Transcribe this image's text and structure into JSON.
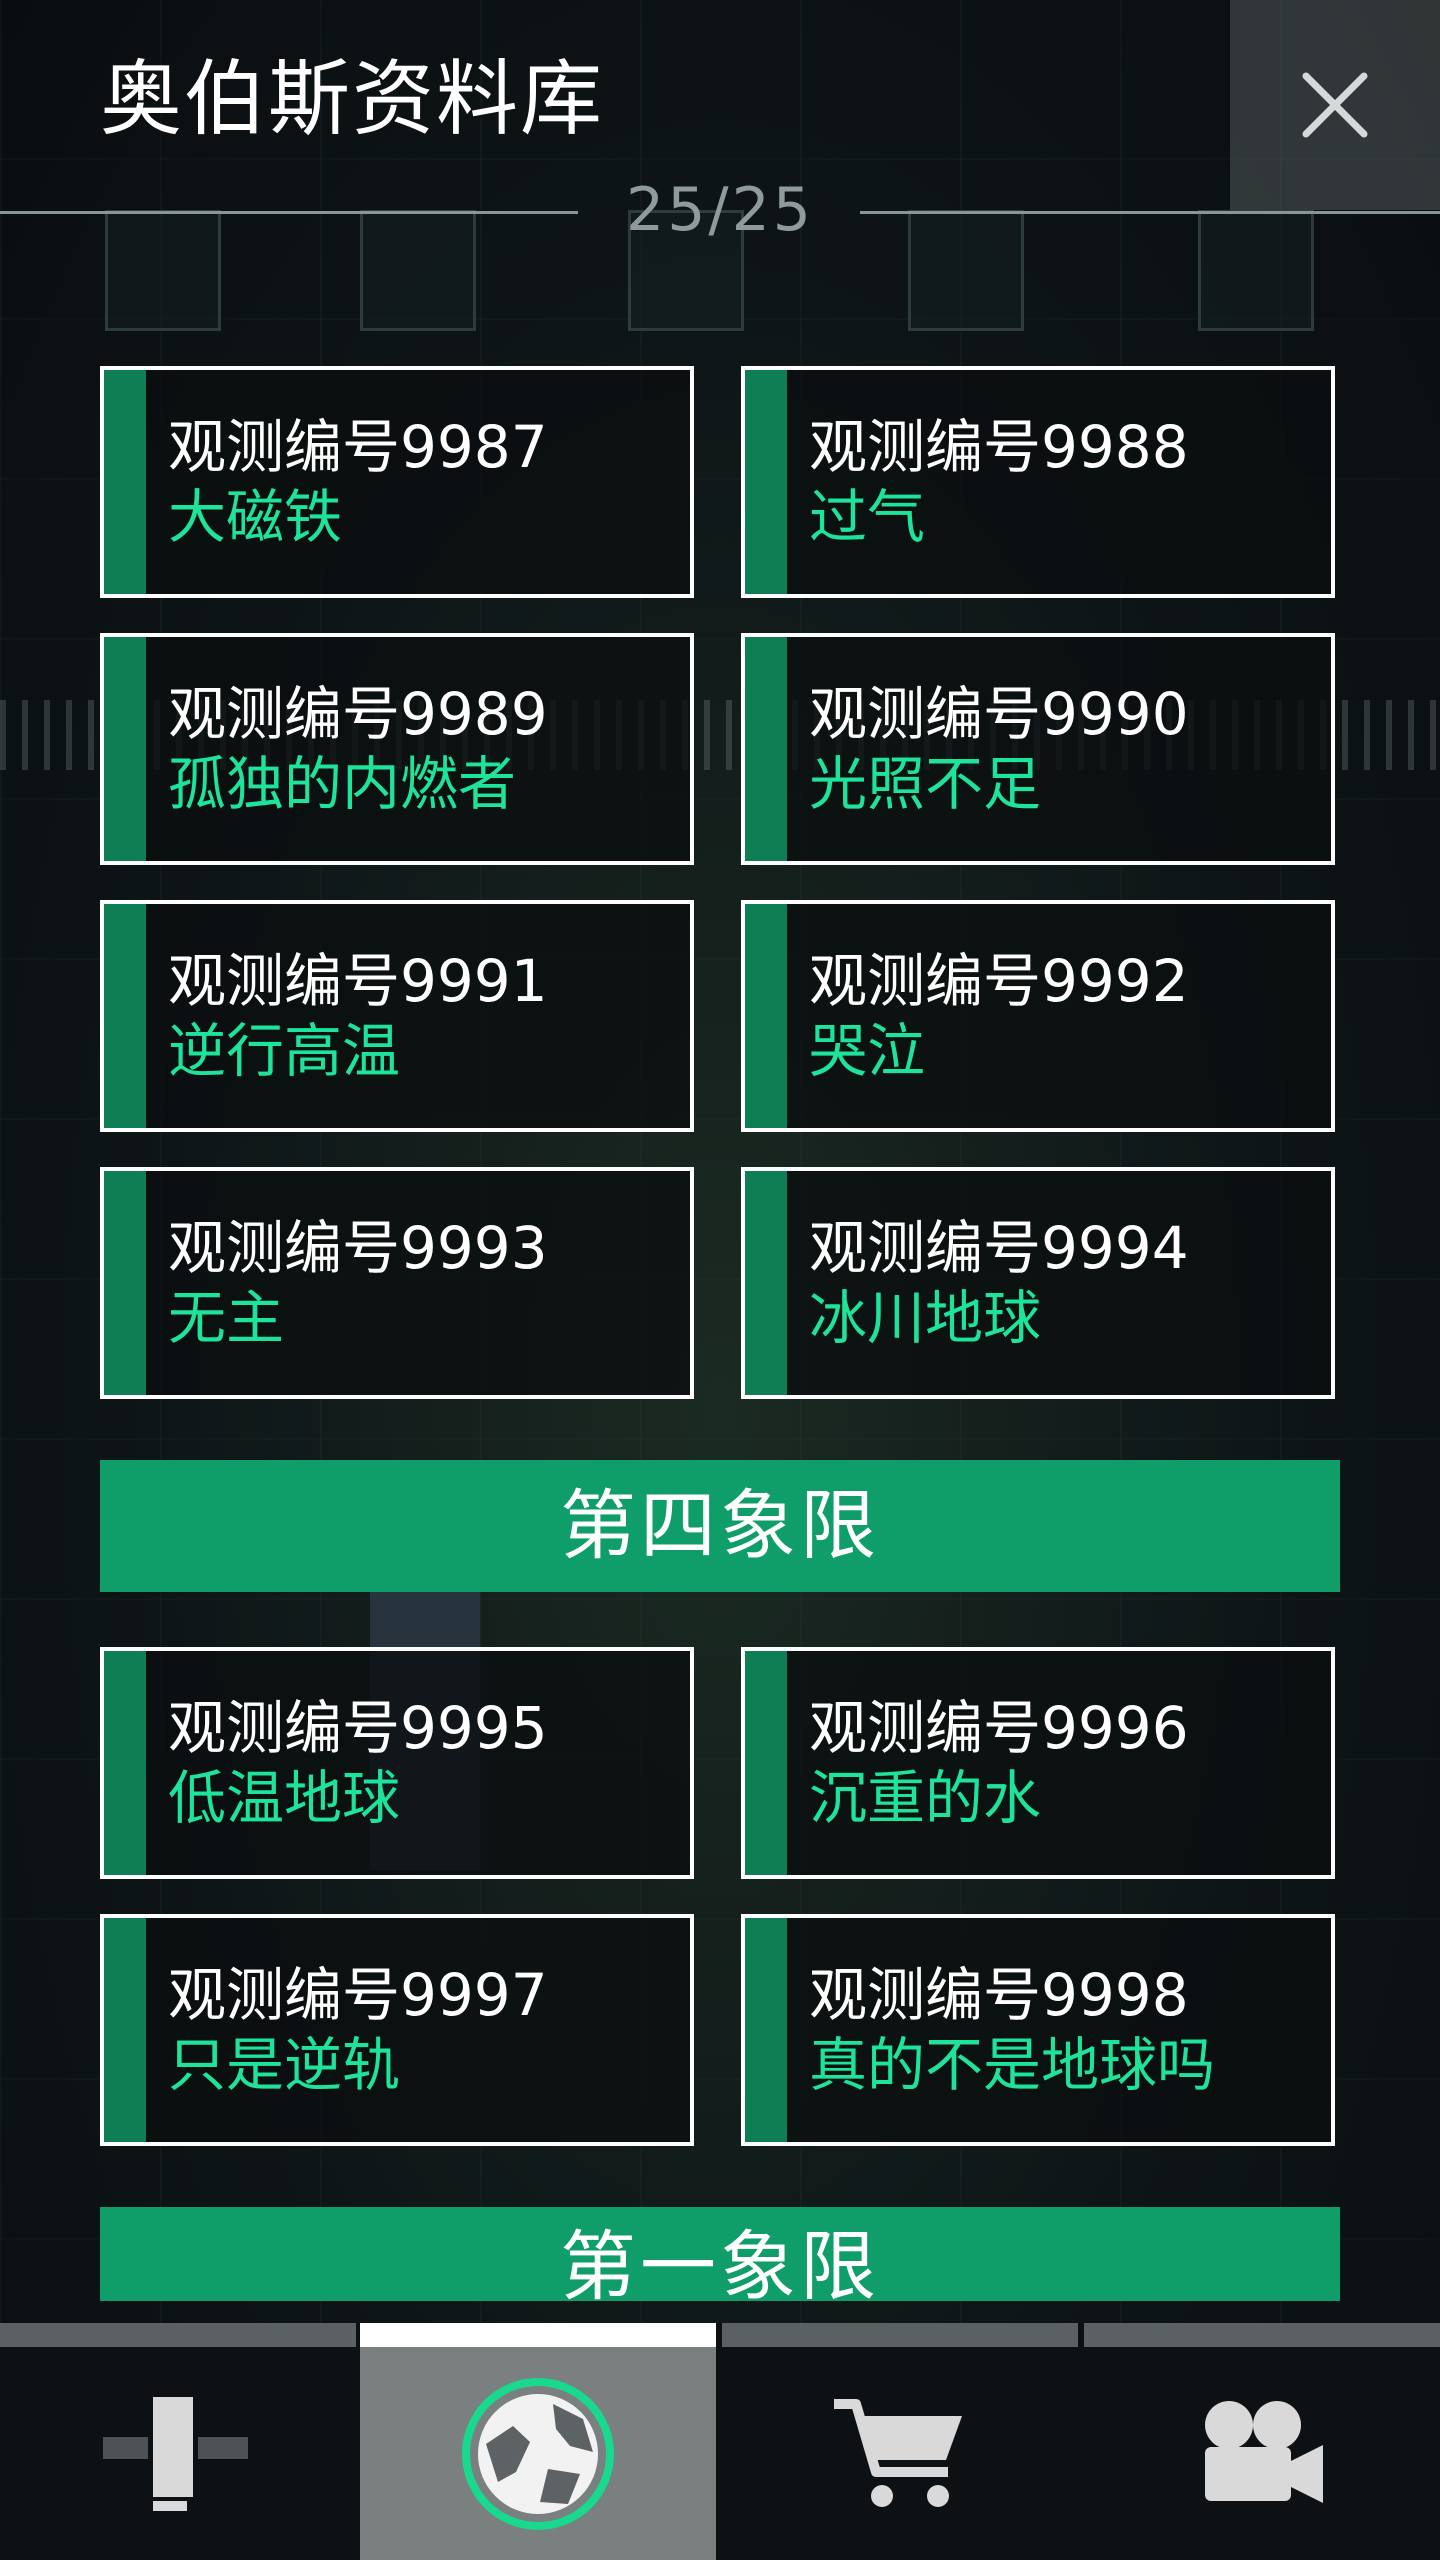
{
  "header": {
    "title": "奥伯斯资料库",
    "page_counter": "25/25",
    "close_icon": "close-icon"
  },
  "cards_group1": [
    {
      "code": "观测编号9987",
      "name": "大磁铁"
    },
    {
      "code": "观测编号9988",
      "name": "过气"
    },
    {
      "code": "观测编号9989",
      "name": "孤独的内燃者"
    },
    {
      "code": "观测编号9990",
      "name": "光照不足"
    },
    {
      "code": "观测编号9991",
      "name": "逆行高温"
    },
    {
      "code": "观测编号9992",
      "name": "哭泣"
    },
    {
      "code": "观测编号9993",
      "name": "无主"
    },
    {
      "code": "观测编号9994",
      "name": "冰川地球"
    }
  ],
  "section4": {
    "label": "第四象限"
  },
  "cards_group2": [
    {
      "code": "观测编号9995",
      "name": "低温地球"
    },
    {
      "code": "观测编号9996",
      "name": "沉重的水"
    },
    {
      "code": "观测编号9997",
      "name": "只是逆轨"
    },
    {
      "code": "观测编号9998",
      "name": "真的不是地球吗"
    }
  ],
  "section_next": {
    "label": "第一象限"
  },
  "bottom_nav": {
    "tabs": [
      {
        "icon": "build-icon",
        "active": false
      },
      {
        "icon": "planet-icon",
        "active": true
      },
      {
        "icon": "cart-icon",
        "active": false
      },
      {
        "icon": "video-camera-icon",
        "active": false
      }
    ]
  },
  "colors": {
    "accent_green": "#0f9e6a",
    "card_bar": "#0e7f55",
    "name_text": "#1ee39b",
    "background": "#0b1012"
  }
}
